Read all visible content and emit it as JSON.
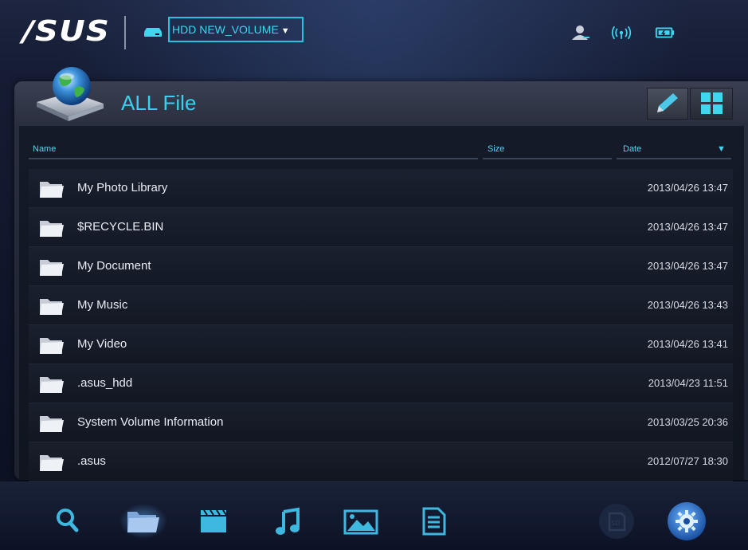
{
  "header": {
    "logo_text": "/SUS",
    "volume_label": "HDD NEW_VOLUME",
    "volume_caret": "▼",
    "icons": [
      "user-icon",
      "wifi-icon",
      "battery-icon"
    ]
  },
  "panel": {
    "title": "ALL File",
    "buttons": [
      "edit-pencil-icon",
      "grid-view-icon"
    ]
  },
  "columns": {
    "name": "Name",
    "size": "Size",
    "date": "Date",
    "sort_indicator": "▼"
  },
  "files": [
    {
      "name": "My Photo Library",
      "date": "2013/04/26 13:47"
    },
    {
      "name": "$RECYCLE.BIN",
      "date": "2013/04/26 13:47"
    },
    {
      "name": "My Document",
      "date": "2013/04/26 13:47"
    },
    {
      "name": "My Music",
      "date": "2013/04/26 13:43"
    },
    {
      "name": "My Video",
      "date": "2013/04/26 13:41"
    },
    {
      "name": ".asus_hdd",
      "date": "2013/04/23 11:51"
    },
    {
      "name": "System Volume Information",
      "date": "2013/03/25 20:36"
    },
    {
      "name": ".asus",
      "date": "2012/07/27 18:30"
    }
  ],
  "bottom_nav": [
    {
      "icon": "search-icon"
    },
    {
      "icon": "folder-icon",
      "active": true
    },
    {
      "icon": "video-clapper-icon"
    },
    {
      "icon": "music-note-icon"
    },
    {
      "icon": "photo-icon"
    },
    {
      "icon": "document-icon"
    },
    {
      "icon": "sd-card-icon",
      "disabled": true
    },
    {
      "icon": "settings-gear-icon"
    }
  ],
  "colors": {
    "accent": "#38d0ef",
    "background": "#0f1528",
    "text": "#e8ecf3"
  }
}
